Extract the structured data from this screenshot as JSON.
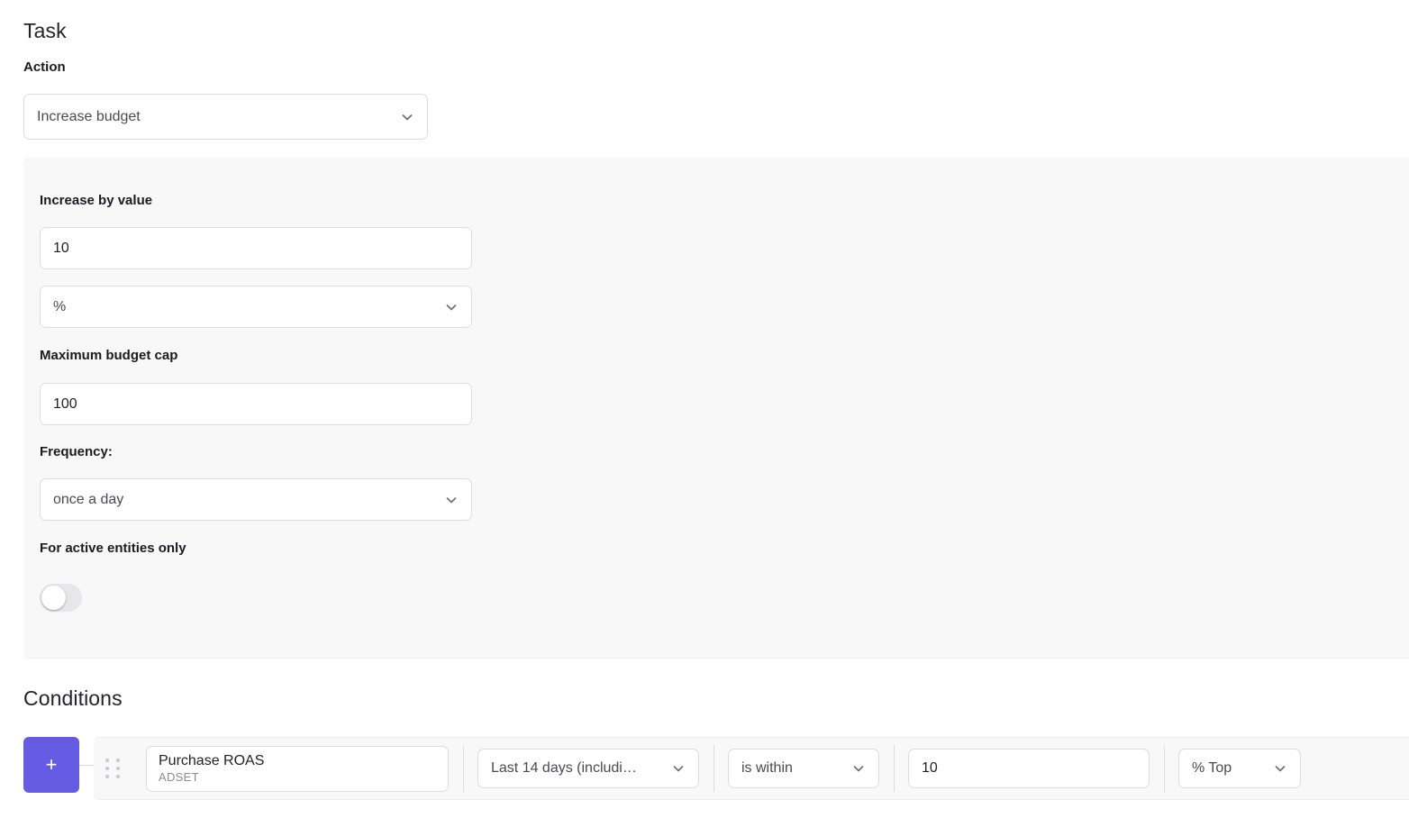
{
  "task": {
    "section_title": "Task",
    "action_label": "Action",
    "action_value": "Increase budget"
  },
  "settings": {
    "increase_by_label": "Increase by value",
    "increase_by_value": "10",
    "increase_unit_value": "%",
    "max_budget_cap_label": "Maximum budget cap",
    "max_budget_cap_value": "100",
    "frequency_label": "Frequency:",
    "frequency_value": "once a day",
    "active_entities_label": "For active entities only",
    "active_entities_toggle": "off"
  },
  "conditions": {
    "section_title": "Conditions",
    "add_button_label": "+",
    "rows": [
      {
        "metric_name": "Purchase ROAS",
        "metric_level": "ADSET",
        "date_range": "Last 14 days (includi…",
        "operator": "is within",
        "value": "10",
        "unit": "% Top"
      }
    ]
  },
  "colors": {
    "accent": "#665ce3",
    "panel_bg": "#f8f8f9",
    "border": "#dcdce3",
    "text": "#1f1f27",
    "muted": "#8b8b96"
  }
}
